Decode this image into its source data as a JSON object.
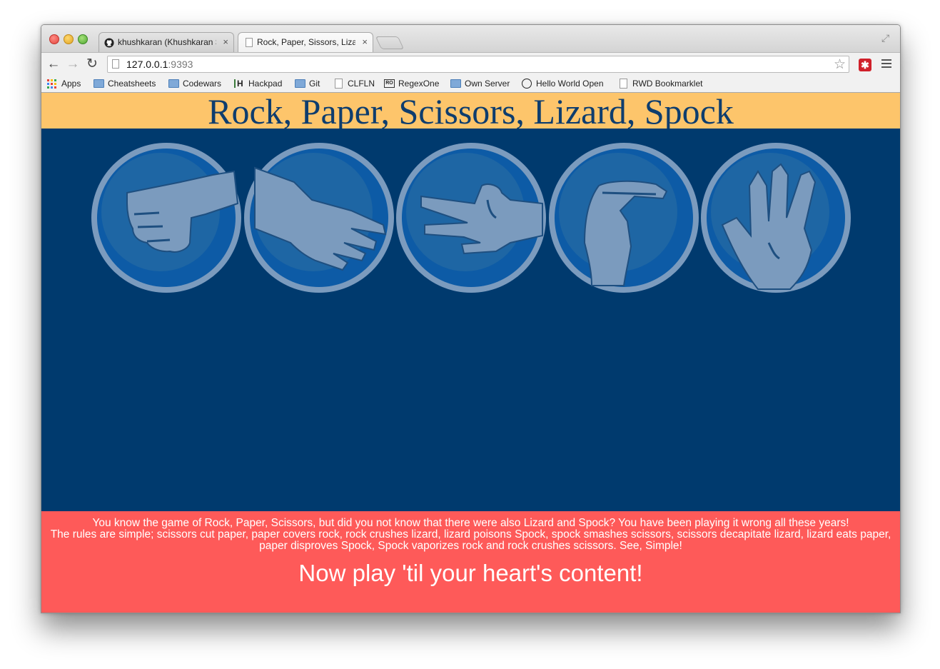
{
  "browser": {
    "tabs": [
      {
        "title": "khushkaran (Khushkaran S",
        "close": "×"
      },
      {
        "title": "Rock, Paper, Sissors, Lizard",
        "close": "×"
      }
    ],
    "url_host": "127.0.0.1",
    "url_port": ":9393",
    "bookmarks": [
      {
        "label": "Apps",
        "icon": "apps-grid-icon"
      },
      {
        "label": "Cheatsheets",
        "icon": "folder-icon"
      },
      {
        "label": "Codewars",
        "icon": "folder-icon"
      },
      {
        "label": "Hackpad",
        "icon": "hackpad-icon"
      },
      {
        "label": "Git",
        "icon": "folder-icon"
      },
      {
        "label": "CLFLN",
        "icon": "page-icon"
      },
      {
        "label": "RegexOne",
        "icon": "regexone-icon"
      },
      {
        "label": "Own Server",
        "icon": "folder-icon"
      },
      {
        "label": "Hello World Open",
        "icon": "hwo-icon"
      },
      {
        "label": "RWD Bookmarklet",
        "icon": "page-icon"
      }
    ]
  },
  "page": {
    "title": "Rock, Paper, Scissors, Lizard, Spock",
    "choices": [
      {
        "name": "rock",
        "icon": "rock-fist-icon"
      },
      {
        "name": "paper",
        "icon": "paper-hand-icon"
      },
      {
        "name": "scissors",
        "icon": "scissors-hand-icon"
      },
      {
        "name": "lizard",
        "icon": "lizard-hand-icon"
      },
      {
        "name": "spock",
        "icon": "spock-hand-icon"
      }
    ],
    "footer": {
      "intro": "You know the game of Rock, Paper, Scissors, but did you not know that there were also Lizard and Spock? You have been playing it wrong all these years!",
      "rules": "The rules are simple; scissors cut paper, paper covers rock, rock crushes lizard, lizard poisons Spock, spock smashes scissors, scissors decapitate lizard, lizard eats paper, paper disproves Spock, Spock vaporizes rock and rock crushes scissors. See, Simple!",
      "cta": "Now play 'til your heart's content!"
    }
  },
  "colors": {
    "header_bg": "#fdc56b",
    "game_bg": "#003a6e",
    "footer_bg": "#fe5a59",
    "title_text": "#0e3d6e"
  }
}
